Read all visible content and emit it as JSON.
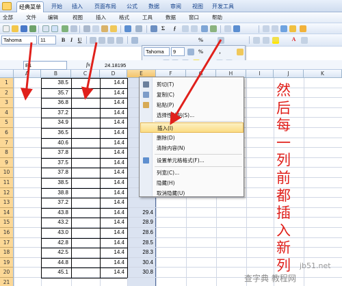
{
  "tabs": [
    "经典菜单",
    "开始",
    "插入",
    "页面布局",
    "公式",
    "数据",
    "审阅",
    "视图",
    "开发工具"
  ],
  "active_tab": "经典菜单",
  "menu_items": [
    "全部",
    "文件",
    "编辑",
    "视图",
    "插入",
    "格式",
    "工具",
    "数据",
    "窗口",
    "帮助"
  ],
  "toolbar": {
    "font_name": "Tahoma",
    "font_size": "11",
    "bold": "B",
    "italic": "I",
    "underline": "U",
    "percent": "%"
  },
  "mini_toolbar": {
    "font_name": "Tahoma",
    "font_size": "9",
    "percent": "%",
    "bold": "B",
    "italic": "I",
    "comma": ","
  },
  "formula_bar": {
    "name_box": "E1",
    "fx": "fx",
    "value": "24.18195"
  },
  "columns": [
    "A",
    "B",
    "C",
    "D",
    "E",
    "F",
    "G",
    "H",
    "I",
    "J",
    "K"
  ],
  "rows": [
    {
      "n": "1",
      "b": "38.5",
      "d": "14.4",
      "e": ""
    },
    {
      "n": "2",
      "b": "35.7",
      "d": "14.4",
      "e": ""
    },
    {
      "n": "3",
      "b": "36.8",
      "d": "14.4",
      "e": ""
    },
    {
      "n": "4",
      "b": "37.2",
      "d": "14.4",
      "e": ""
    },
    {
      "n": "5",
      "b": "34.9",
      "d": "14.4",
      "e": ""
    },
    {
      "n": "6",
      "b": "36.5",
      "d": "14.4",
      "e": ""
    },
    {
      "n": "7",
      "b": "40.6",
      "d": "14.4",
      "e": ""
    },
    {
      "n": "8",
      "b": "37.8",
      "d": "14.4",
      "e": ""
    },
    {
      "n": "9",
      "b": "37.5",
      "d": "14.4",
      "e": ""
    },
    {
      "n": "10",
      "b": "37.8",
      "d": "14.4",
      "e": ""
    },
    {
      "n": "11",
      "b": "38.5",
      "d": "14.4",
      "e": ""
    },
    {
      "n": "12",
      "b": "38.8",
      "d": "14.4",
      "e": ""
    },
    {
      "n": "13",
      "b": "37.2",
      "d": "14.4",
      "e": ""
    },
    {
      "n": "14",
      "b": "43.8",
      "d": "14.4",
      "e": "29.4"
    },
    {
      "n": "15",
      "b": "43.2",
      "d": "14.4",
      "e": "28.9"
    },
    {
      "n": "16",
      "b": "43.0",
      "d": "14.4",
      "e": "28.6"
    },
    {
      "n": "17",
      "b": "42.8",
      "d": "14.4",
      "e": "28.5"
    },
    {
      "n": "18",
      "b": "42.5",
      "d": "14.4",
      "e": "28.3"
    },
    {
      "n": "19",
      "b": "44.8",
      "d": "14.4",
      "e": "30.4"
    },
    {
      "n": "20",
      "b": "45.1",
      "d": "14.4",
      "e": "30.8"
    },
    {
      "n": "21",
      "b": "",
      "d": "",
      "e": ""
    }
  ],
  "partial_labels": {
    "d3_suffix": "数",
    "d5_suffix": "数",
    "watermark_cell": "ajiaocheng.chazidian.com"
  },
  "context_menu": [
    {
      "label": "剪切(T)",
      "icon": "scissors-icon"
    },
    {
      "label": "复制(C)",
      "icon": "copy-icon"
    },
    {
      "label": "粘贴(P)",
      "icon": "paste-icon"
    },
    {
      "label": "选择性粘贴(S)...",
      "icon": ""
    },
    {
      "label": "插入(I)",
      "icon": "",
      "highlighted": true
    },
    {
      "label": "删除(D)",
      "icon": ""
    },
    {
      "label": "清除内容(N)",
      "icon": ""
    },
    {
      "label": "设置单元格格式(F)...",
      "icon": "format-cells-icon"
    },
    {
      "label": "列宽(C)...",
      "icon": ""
    },
    {
      "label": "隐藏(H)",
      "icon": ""
    },
    {
      "label": "取消隐藏(U)",
      "icon": ""
    }
  ],
  "annotation": {
    "chars": [
      "然",
      "后",
      "每",
      "一",
      "列",
      "前",
      "都",
      "插",
      "入",
      "新",
      "列"
    ],
    "color": "#e0201b"
  },
  "watermarks": {
    "bottom_left": "查字典 教程网",
    "bottom_right": "jb51.net",
    "bottom_url": "jiaocheng.chazidian.com"
  },
  "colors": {
    "arrow": "#e0201b",
    "row_header_selected": "#fcd896",
    "menu_highlight": "#fbdc84"
  }
}
